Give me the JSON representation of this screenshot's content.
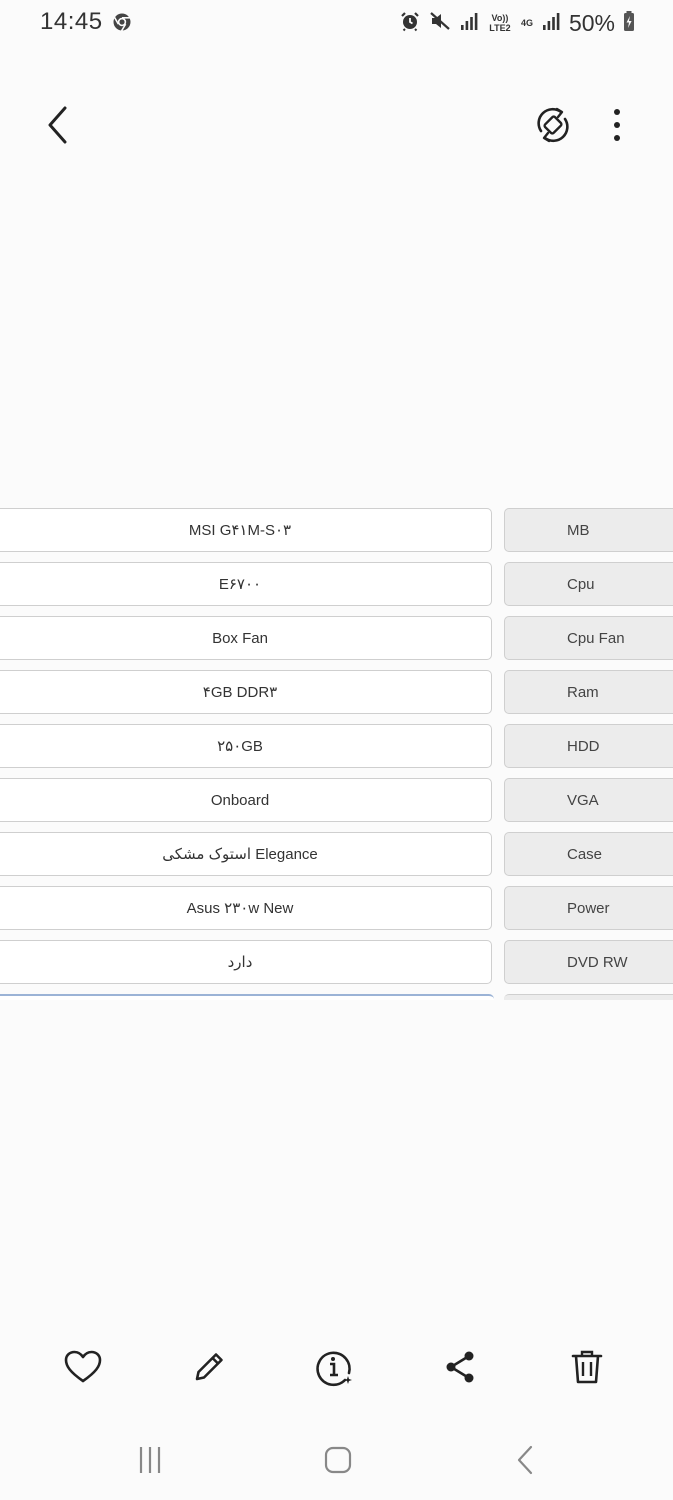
{
  "status_bar": {
    "time": "14:45",
    "battery_percent": "50%",
    "network_labels": {
      "volte": "Vo)) LTE2",
      "gen": "4G"
    },
    "icons": [
      "chrome-icon",
      "alarm-icon",
      "mute-icon",
      "signal-icon",
      "signal-icon",
      "battery-charging-icon"
    ]
  },
  "top_bar": {
    "icons": {
      "back": "back-icon",
      "rotate": "rotate-icon",
      "more": "more-options-icon"
    }
  },
  "spec_table": {
    "rows": [
      {
        "label": "MB",
        "value": "MSI G۴۱M-S۰۳"
      },
      {
        "label": "Cpu",
        "value": "E۶۷۰۰"
      },
      {
        "label": "Cpu Fan",
        "value": "Box Fan"
      },
      {
        "label": "Ram",
        "value": "۴GB DDR۳"
      },
      {
        "label": "HDD",
        "value": "۲۵۰GB"
      },
      {
        "label": "VGA",
        "value": "Onboard"
      },
      {
        "label": "Case",
        "value": "استوک مشکی  Elegance"
      },
      {
        "label": "Power",
        "value": "Asus ۲۳۰w  New"
      },
      {
        "label": "DVD RW",
        "value": "دارد"
      }
    ]
  },
  "bottom_actions": {
    "icons": [
      "heart-icon",
      "edit-icon",
      "info-icon",
      "share-icon",
      "delete-icon"
    ]
  },
  "nav_bar": {
    "icons": [
      "recents-icon",
      "home-icon",
      "nav-back-icon"
    ]
  },
  "colors": {
    "background": "#fbfbfb",
    "cell_border": "#cfcfcf",
    "label_fill": "#ececec",
    "icon": "#2a2a2a"
  }
}
